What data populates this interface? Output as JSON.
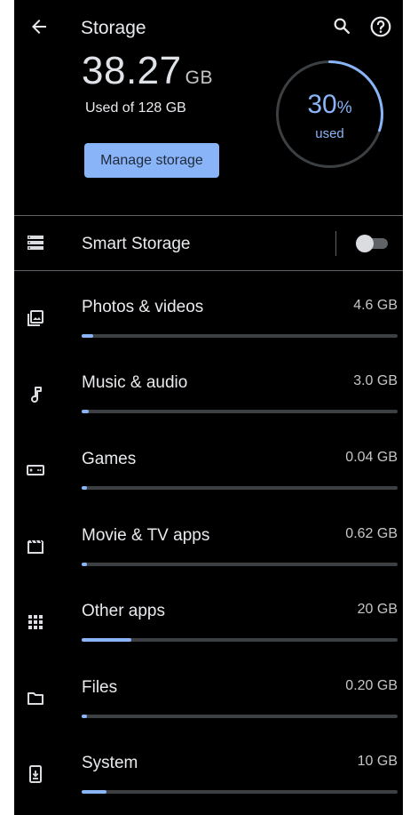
{
  "header": {
    "title": "Storage",
    "used_value": "38.27",
    "used_unit": "GB",
    "used_of": "Used of 128 GB",
    "manage_label": "Manage storage"
  },
  "ring": {
    "percent": "30",
    "percent_sign": "%",
    "label": "used",
    "fraction": 0.3
  },
  "smart_storage": {
    "label": "Smart Storage",
    "enabled": false
  },
  "categories": [
    {
      "label": "Photos & videos",
      "size": "4.6 GB",
      "fraction": 0.036
    },
    {
      "label": "Music & audio",
      "size": "3.0 GB",
      "fraction": 0.023
    },
    {
      "label": "Games",
      "size": "0.04 GB",
      "fraction": 0.0
    },
    {
      "label": "Movie & TV apps",
      "size": "0.62 GB",
      "fraction": 0.005
    },
    {
      "label": "Other apps",
      "size": "20 GB",
      "fraction": 0.156
    },
    {
      "label": "Files",
      "size": "0.20 GB",
      "fraction": 0.002
    },
    {
      "label": "System",
      "size": "10 GB",
      "fraction": 0.078
    }
  ],
  "colors": {
    "accent": "#8ab4f8",
    "background": "#000000",
    "track": "#3c4043"
  },
  "icons": {
    "back": "arrow-back-icon",
    "search": "search-icon",
    "help": "help-icon",
    "smart": "storage-list-icon"
  }
}
